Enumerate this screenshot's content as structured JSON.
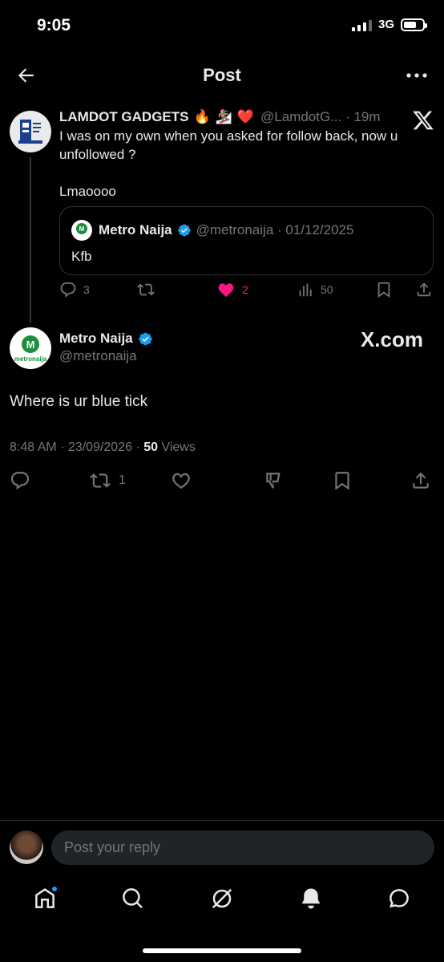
{
  "status_bar": {
    "time": "9:05",
    "network": "3G"
  },
  "header": {
    "title": "Post"
  },
  "parent_tweet": {
    "author_name": "LAMDOT GADGETS",
    "emojis": [
      "🔥",
      "🏂",
      "❤️"
    ],
    "handle": "@LamdotG... · 19m",
    "text_line1": "I was on my own when you asked for follow back, now u unfollowed ?",
    "text_line2": "Lmaoooo",
    "quoted": {
      "author_name": "Metro Naija",
      "handle_date": "@metronaija · 01/12/2025",
      "text": "Kfb"
    },
    "actions": {
      "replies": "3",
      "likes": "2",
      "views": "50"
    }
  },
  "main_tweet": {
    "author_name": "Metro Naija",
    "handle": "@metronaija",
    "watermark": "X.com",
    "avatar_label": "metronaija",
    "text": "Where is ur blue tick",
    "timestamp": "8:48 AM · 23/09/2026 · ",
    "views_count": "50",
    "views_label": " Views",
    "actions": {
      "reposts": "1"
    }
  },
  "reply": {
    "placeholder": "Post your reply"
  },
  "colors": {
    "accent": "#1d9bf0",
    "like": "#f91880",
    "muted": "#71767b",
    "brand_green": "#1e8e3e"
  }
}
